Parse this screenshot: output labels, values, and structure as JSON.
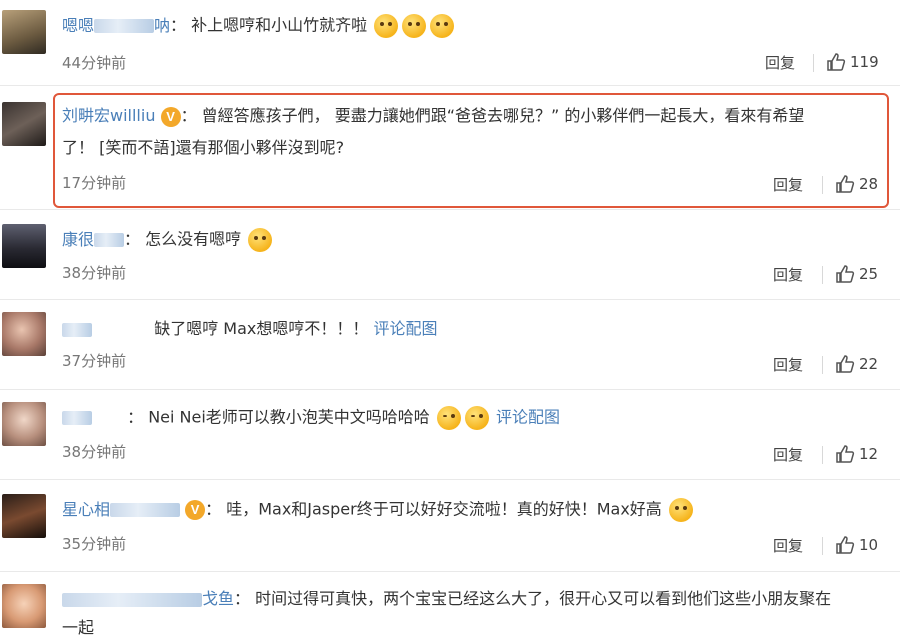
{
  "comments": [
    {
      "name": "嗯嗯",
      "name_tail": "呐",
      "text": "补上嗯哼和小山竹就齐啦",
      "time": "44分钟前",
      "reply": "回复",
      "likes": "119",
      "emoji_count": 3
    },
    {
      "name": "刘畊宏willliu",
      "text1": "曾經答應孩子們， 要盡力讓她們跟“爸爸去哪兒？” 的小夥伴們一起長大，看來有希望",
      "text2": "了！ [笑而不語]還有那個小夥伴沒到呢?",
      "time": "17分钟前",
      "reply": "回复",
      "likes": "28"
    },
    {
      "name": "康很",
      "text": "怎么没有嗯哼",
      "time": "38分钟前",
      "reply": "回复",
      "likes": "25"
    },
    {
      "text": "缺了嗯哼 Max想嗯哼不！！！",
      "link": "评论配图",
      "time": "37分钟前",
      "reply": "回复",
      "likes": "22"
    },
    {
      "text": "Nei Nei老师可以教小泡芙中文吗哈哈哈",
      "link": "评论配图",
      "time": "38分钟前",
      "reply": "回复",
      "likes": "12"
    },
    {
      "name": "星心相",
      "text": "哇，Max和Jasper终于可以好好交流啦！真的好快！Max好高",
      "time": "35分钟前",
      "reply": "回复",
      "likes": "10"
    },
    {
      "name_tail": "戈鱼",
      "text1": "时间过得可真快，两个宝宝已经这么大了，很开心又可以看到他们这些小朋友聚在",
      "text2": "一起"
    }
  ],
  "colors": {
    "name": "#4a7fb8",
    "highlight": "#e0573a"
  }
}
